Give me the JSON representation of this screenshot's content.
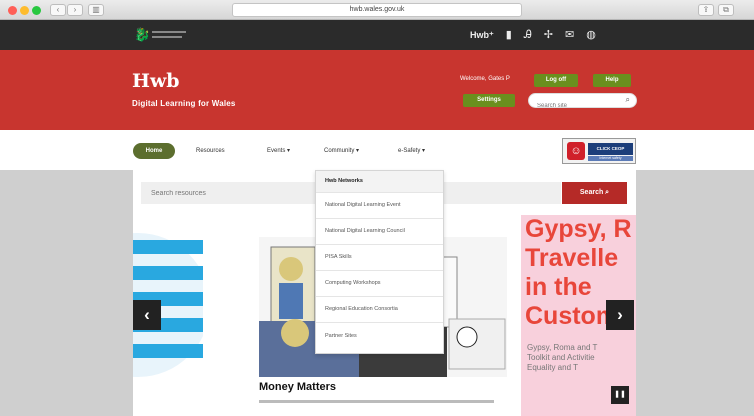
{
  "browser": {
    "url": "hwb.wales.gov.uk",
    "back": "‹",
    "forward": "›",
    "sidebar": "▥",
    "share": "⇪",
    "tabs": "⧉"
  },
  "gov_bar": {
    "hwb_label": "Hwb⁺",
    "icons": [
      "office-icon",
      "translate-icon",
      "network-icon",
      "mail-icon",
      "globe-icon"
    ]
  },
  "banner": {
    "brand": "Hwb",
    "tagline": "Digital Learning for Wales",
    "welcome": "Welcome, Gates P",
    "logoff": "Log off",
    "help": "Help",
    "settings": "Settings",
    "search_placeholder": "Search site"
  },
  "nav": {
    "home": "Home",
    "resources": "Resources",
    "events": "Events ▾",
    "community": "Community ▾",
    "esafety": "e-Safety ▾"
  },
  "ceop": {
    "tag": "CLICK CEOP",
    "sub": "Internet safety"
  },
  "content": {
    "search_placeholder": "Search resources",
    "search_button": "Search ⌕"
  },
  "carousel": {
    "slide_title": "Money Matters",
    "poster_lines": [
      "Gypsy, R",
      "Travelle",
      "in the ",
      "Custom"
    ],
    "poster_body": [
      "Gypsy, Roma and T",
      "Toolkit and Activitie",
      "Equality and T"
    ],
    "prev": "‹",
    "next": "›",
    "pause": "❚❚"
  },
  "dropdown": {
    "items": [
      "Hwb Networks",
      "National Digital Learning Event",
      "National Digital Learning Council",
      "PISA Skills",
      "Computing Workshops",
      "Regional Education Consortia",
      "Partner Sites"
    ]
  }
}
